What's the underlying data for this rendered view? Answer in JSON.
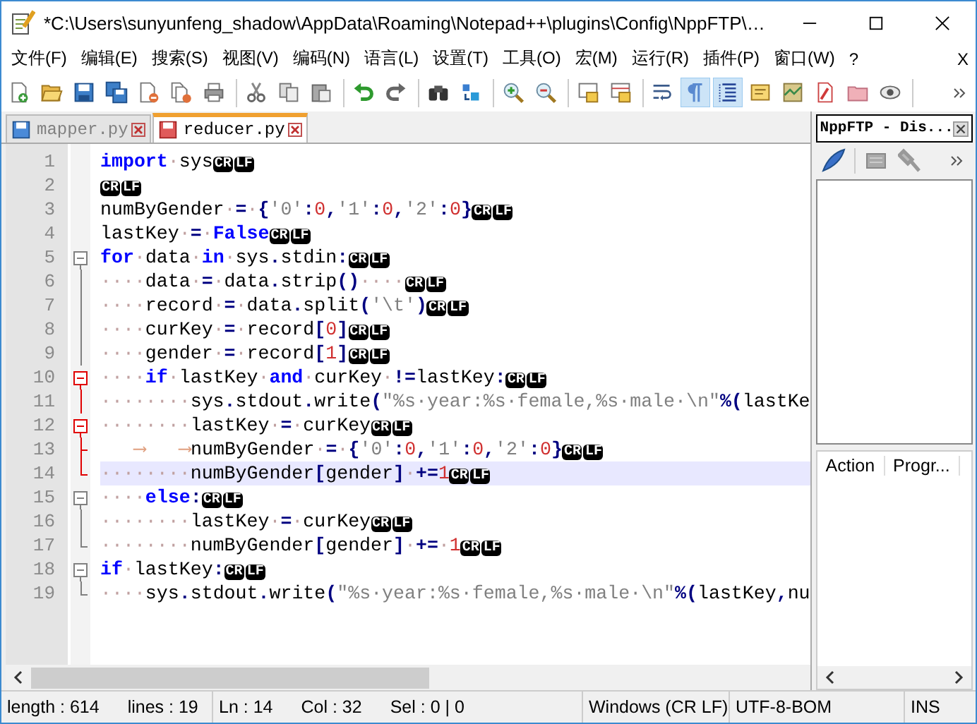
{
  "window": {
    "title": "*C:\\Users\\sunyunfeng_shadow\\AppData\\Roaming\\Notepad++\\plugins\\Config\\NppFTP\\…"
  },
  "menu": [
    "文件(F)",
    "编辑(E)",
    "搜索(S)",
    "视图(V)",
    "编码(N)",
    "语言(L)",
    "设置(T)",
    "工具(O)",
    "宏(M)",
    "运行(R)",
    "插件(P)",
    "窗口(W)",
    "?"
  ],
  "menu_close": "X",
  "toolbar": [
    {
      "kind": "new",
      "pressed": false
    },
    {
      "kind": "open",
      "pressed": false
    },
    {
      "kind": "save",
      "pressed": false
    },
    {
      "kind": "saveall",
      "pressed": false
    },
    {
      "kind": "close",
      "pressed": false
    },
    {
      "kind": "closeall",
      "pressed": false
    },
    {
      "kind": "print",
      "pressed": false
    },
    {
      "kind": "separator"
    },
    {
      "kind": "cut",
      "pressed": false
    },
    {
      "kind": "copy",
      "pressed": false
    },
    {
      "kind": "paste",
      "pressed": false
    },
    {
      "kind": "separator"
    },
    {
      "kind": "undo",
      "pressed": false
    },
    {
      "kind": "redo",
      "pressed": false
    },
    {
      "kind": "separator"
    },
    {
      "kind": "find",
      "pressed": false
    },
    {
      "kind": "replace",
      "pressed": false
    },
    {
      "kind": "separator"
    },
    {
      "kind": "zoomin",
      "pressed": false
    },
    {
      "kind": "zoomout",
      "pressed": false
    },
    {
      "kind": "separator"
    },
    {
      "kind": "syncv",
      "pressed": false
    },
    {
      "kind": "synch",
      "pressed": false
    },
    {
      "kind": "separator"
    },
    {
      "kind": "wrap",
      "pressed": false
    },
    {
      "kind": "pilcrow",
      "pressed": true
    },
    {
      "kind": "indent",
      "pressed": true
    },
    {
      "kind": "note",
      "pressed": false
    },
    {
      "kind": "map",
      "pressed": false
    },
    {
      "kind": "funclist",
      "pressed": false
    },
    {
      "kind": "folder",
      "pressed": false
    },
    {
      "kind": "eye",
      "pressed": false
    },
    {
      "kind": "separator"
    }
  ],
  "tabs": [
    {
      "label": "mapper.py",
      "selected": false,
      "modified": false
    },
    {
      "label": "reducer.py",
      "selected": true,
      "modified": true
    }
  ],
  "lines": [
    {
      "number": "1",
      "current": false,
      "tokens": [
        {
          "kind": "kw",
          "text": "import"
        },
        {
          "kind": "ws",
          "text": "·"
        },
        {
          "kind": "id",
          "text": "sys"
        },
        {
          "kind": "eol",
          "text": "CR"
        },
        {
          "kind": "eol",
          "text": "LF"
        }
      ]
    },
    {
      "number": "2",
      "current": false,
      "tokens": [
        {
          "kind": "eol",
          "text": "CR"
        },
        {
          "kind": "eol",
          "text": "LF"
        }
      ]
    },
    {
      "number": "3",
      "current": false,
      "tokens": [
        {
          "kind": "id",
          "text": "numByGender"
        },
        {
          "kind": "ws",
          "text": "·"
        },
        {
          "kind": "op",
          "text": "="
        },
        {
          "kind": "ws",
          "text": "·"
        },
        {
          "kind": "op",
          "text": "{"
        },
        {
          "kind": "str",
          "text": "'0'"
        },
        {
          "kind": "op",
          "text": ":"
        },
        {
          "kind": "num",
          "text": "0"
        },
        {
          "kind": "op",
          "text": ","
        },
        {
          "kind": "str",
          "text": "'1'"
        },
        {
          "kind": "op",
          "text": ":"
        },
        {
          "kind": "num",
          "text": "0"
        },
        {
          "kind": "op",
          "text": ","
        },
        {
          "kind": "str",
          "text": "'2'"
        },
        {
          "kind": "op",
          "text": ":"
        },
        {
          "kind": "num",
          "text": "0"
        },
        {
          "kind": "op",
          "text": "}"
        },
        {
          "kind": "eol",
          "text": "CR"
        },
        {
          "kind": "eol",
          "text": "LF"
        }
      ]
    },
    {
      "number": "4",
      "current": false,
      "tokens": [
        {
          "kind": "id",
          "text": "lastKey"
        },
        {
          "kind": "ws",
          "text": "·"
        },
        {
          "kind": "op",
          "text": "="
        },
        {
          "kind": "ws",
          "text": "·"
        },
        {
          "kind": "kw",
          "text": "False"
        },
        {
          "kind": "eol",
          "text": "CR"
        },
        {
          "kind": "eol",
          "text": "LF"
        }
      ]
    },
    {
      "number": "5",
      "fold_marker": {
        "kind": "open",
        "active": false
      },
      "current": false,
      "tokens": [
        {
          "kind": "kw",
          "text": "for"
        },
        {
          "kind": "ws",
          "text": "·"
        },
        {
          "kind": "id",
          "text": "data"
        },
        {
          "kind": "ws",
          "text": "·"
        },
        {
          "kind": "kw",
          "text": "in"
        },
        {
          "kind": "ws",
          "text": "·"
        },
        {
          "kind": "id",
          "text": "sys"
        },
        {
          "kind": "op",
          "text": "."
        },
        {
          "kind": "id",
          "text": "stdin"
        },
        {
          "kind": "op",
          "text": ":"
        },
        {
          "kind": "eol",
          "text": "CR"
        },
        {
          "kind": "eol",
          "text": "LF"
        }
      ]
    },
    {
      "number": "6",
      "fold_marker": {
        "kind": "line",
        "active": false
      },
      "current": false,
      "tokens": [
        {
          "kind": "ws",
          "text": "····"
        },
        {
          "kind": "id",
          "text": "data"
        },
        {
          "kind": "ws",
          "text": "·"
        },
        {
          "kind": "op",
          "text": "="
        },
        {
          "kind": "ws",
          "text": "·"
        },
        {
          "kind": "id",
          "text": "data"
        },
        {
          "kind": "op",
          "text": "."
        },
        {
          "kind": "id",
          "text": "strip"
        },
        {
          "kind": "op",
          "text": "()"
        },
        {
          "kind": "ws",
          "text": "····"
        },
        {
          "kind": "eol",
          "text": "CR"
        },
        {
          "kind": "eol",
          "text": "LF"
        }
      ]
    },
    {
      "number": "7",
      "fold_marker": {
        "kind": "line",
        "active": false
      },
      "current": false,
      "tokens": [
        {
          "kind": "ws",
          "text": "····"
        },
        {
          "kind": "id",
          "text": "record"
        },
        {
          "kind": "ws",
          "text": "·"
        },
        {
          "kind": "op",
          "text": "="
        },
        {
          "kind": "ws",
          "text": "·"
        },
        {
          "kind": "id",
          "text": "data"
        },
        {
          "kind": "op",
          "text": "."
        },
        {
          "kind": "id",
          "text": "split"
        },
        {
          "kind": "op",
          "text": "("
        },
        {
          "kind": "str",
          "text": "'\\t'"
        },
        {
          "kind": "op",
          "text": ")"
        },
        {
          "kind": "eol",
          "text": "CR"
        },
        {
          "kind": "eol",
          "text": "LF"
        }
      ]
    },
    {
      "number": "8",
      "fold_marker": {
        "kind": "line",
        "active": false
      },
      "current": false,
      "tokens": [
        {
          "kind": "ws",
          "text": "····"
        },
        {
          "kind": "id",
          "text": "curKey"
        },
        {
          "kind": "ws",
          "text": "·"
        },
        {
          "kind": "op",
          "text": "="
        },
        {
          "kind": "ws",
          "text": "·"
        },
        {
          "kind": "id",
          "text": "record"
        },
        {
          "kind": "op",
          "text": "["
        },
        {
          "kind": "num",
          "text": "0"
        },
        {
          "kind": "op",
          "text": "]"
        },
        {
          "kind": "eol",
          "text": "CR"
        },
        {
          "kind": "eol",
          "text": "LF"
        }
      ]
    },
    {
      "number": "9",
      "fold_marker": {
        "kind": "line",
        "active": false
      },
      "current": false,
      "tokens": [
        {
          "kind": "ws",
          "text": "····"
        },
        {
          "kind": "id",
          "text": "gender"
        },
        {
          "kind": "ws",
          "text": "·"
        },
        {
          "kind": "op",
          "text": "="
        },
        {
          "kind": "ws",
          "text": "·"
        },
        {
          "kind": "id",
          "text": "record"
        },
        {
          "kind": "op",
          "text": "["
        },
        {
          "kind": "num",
          "text": "1"
        },
        {
          "kind": "op",
          "text": "]"
        },
        {
          "kind": "eol",
          "text": "CR"
        },
        {
          "kind": "eol",
          "text": "LF"
        }
      ]
    },
    {
      "number": "10",
      "fold_marker": {
        "kind": "open",
        "active": true
      },
      "current": false,
      "tokens": [
        {
          "kind": "ws",
          "text": "····"
        },
        {
          "kind": "kw",
          "text": "if"
        },
        {
          "kind": "ws",
          "text": "·"
        },
        {
          "kind": "id",
          "text": "lastKey"
        },
        {
          "kind": "ws",
          "text": "·"
        },
        {
          "kind": "kw",
          "text": "and"
        },
        {
          "kind": "ws",
          "text": "·"
        },
        {
          "kind": "id",
          "text": "curKey"
        },
        {
          "kind": "ws",
          "text": "·"
        },
        {
          "kind": "op",
          "text": "!="
        },
        {
          "kind": "id",
          "text": "lastKey"
        },
        {
          "kind": "op",
          "text": ":"
        },
        {
          "kind": "eol",
          "text": "CR"
        },
        {
          "kind": "eol",
          "text": "LF"
        }
      ]
    },
    {
      "number": "11",
      "fold_marker": {
        "kind": "line",
        "active": true
      },
      "current": false,
      "tokens": [
        {
          "kind": "ws",
          "text": "········"
        },
        {
          "kind": "id",
          "text": "sys"
        },
        {
          "kind": "op",
          "text": "."
        },
        {
          "kind": "id",
          "text": "stdout"
        },
        {
          "kind": "op",
          "text": "."
        },
        {
          "kind": "id",
          "text": "write"
        },
        {
          "kind": "op",
          "text": "("
        },
        {
          "kind": "str",
          "text": "\"%s·year:%s·female,%s·male·\\n\""
        },
        {
          "kind": "op",
          "text": "%("
        },
        {
          "kind": "id",
          "text": "lastKe"
        }
      ]
    },
    {
      "number": "12",
      "fold_marker": {
        "kind": "open",
        "active": true
      },
      "current": false,
      "tokens": [
        {
          "kind": "ws",
          "text": "········"
        },
        {
          "kind": "id",
          "text": "lastKey"
        },
        {
          "kind": "ws",
          "text": "·"
        },
        {
          "kind": "op",
          "text": "="
        },
        {
          "kind": "ws",
          "text": "·"
        },
        {
          "kind": "id",
          "text": "curKey"
        },
        {
          "kind": "eol",
          "text": "CR"
        },
        {
          "kind": "eol",
          "text": "LF"
        }
      ]
    },
    {
      "number": "13",
      "fold_marker": {
        "kind": "branch",
        "active": true
      },
      "current": false,
      "tokens": [
        {
          "kind": "tab",
          "text": "⟶"
        },
        {
          "kind": "tab",
          "text": "⟶"
        },
        {
          "kind": "id",
          "text": "numByGender"
        },
        {
          "kind": "ws",
          "text": "·"
        },
        {
          "kind": "op",
          "text": "="
        },
        {
          "kind": "ws",
          "text": "·"
        },
        {
          "kind": "op",
          "text": "{"
        },
        {
          "kind": "str",
          "text": "'0'"
        },
        {
          "kind": "op",
          "text": ":"
        },
        {
          "kind": "num",
          "text": "0"
        },
        {
          "kind": "op",
          "text": ","
        },
        {
          "kind": "str",
          "text": "'1'"
        },
        {
          "kind": "op",
          "text": ":"
        },
        {
          "kind": "num",
          "text": "0"
        },
        {
          "kind": "op",
          "text": ","
        },
        {
          "kind": "str",
          "text": "'2'"
        },
        {
          "kind": "op",
          "text": ":"
        },
        {
          "kind": "num",
          "text": "0"
        },
        {
          "kind": "op",
          "text": "}"
        },
        {
          "kind": "eol",
          "text": "CR"
        },
        {
          "kind": "eol",
          "text": "LF"
        }
      ]
    },
    {
      "number": "14",
      "fold_marker": {
        "kind": "end",
        "active": true
      },
      "current": true,
      "tokens": [
        {
          "kind": "ws",
          "text": "········"
        },
        {
          "kind": "id",
          "text": "numByGender"
        },
        {
          "kind": "op",
          "text": "["
        },
        {
          "kind": "id",
          "text": "gender"
        },
        {
          "kind": "op",
          "text": "]"
        },
        {
          "kind": "ws",
          "text": "·"
        },
        {
          "kind": "op",
          "text": "+="
        },
        {
          "kind": "num",
          "text": "1"
        },
        {
          "kind": "eol",
          "text": "CR"
        },
        {
          "kind": "eol",
          "text": "LF"
        }
      ]
    },
    {
      "number": "15",
      "fold_marker": {
        "kind": "open",
        "active": false
      },
      "current": false,
      "tokens": [
        {
          "kind": "ws",
          "text": "····"
        },
        {
          "kind": "kw",
          "text": "else"
        },
        {
          "kind": "op",
          "text": ":"
        },
        {
          "kind": "eol",
          "text": "CR"
        },
        {
          "kind": "eol",
          "text": "LF"
        }
      ]
    },
    {
      "number": "16",
      "fold_marker": {
        "kind": "line",
        "active": false
      },
      "current": false,
      "tokens": [
        {
          "kind": "ws",
          "text": "········"
        },
        {
          "kind": "id",
          "text": "lastKey"
        },
        {
          "kind": "ws",
          "text": "·"
        },
        {
          "kind": "op",
          "text": "="
        },
        {
          "kind": "ws",
          "text": "·"
        },
        {
          "kind": "id",
          "text": "curKey"
        },
        {
          "kind": "eol",
          "text": "CR"
        },
        {
          "kind": "eol",
          "text": "LF"
        }
      ]
    },
    {
      "number": "17",
      "fold_marker": {
        "kind": "end",
        "active": false
      },
      "current": false,
      "tokens": [
        {
          "kind": "ws",
          "text": "········"
        },
        {
          "kind": "id",
          "text": "numByGender"
        },
        {
          "kind": "op",
          "text": "["
        },
        {
          "kind": "id",
          "text": "gender"
        },
        {
          "kind": "op",
          "text": "]"
        },
        {
          "kind": "ws",
          "text": "·"
        },
        {
          "kind": "op",
          "text": "+="
        },
        {
          "kind": "ws",
          "text": "·"
        },
        {
          "kind": "num",
          "text": "1"
        },
        {
          "kind": "eol",
          "text": "CR"
        },
        {
          "kind": "eol",
          "text": "LF"
        }
      ]
    },
    {
      "number": "18",
      "fold_marker": {
        "kind": "open",
        "active": false
      },
      "current": false,
      "tokens": [
        {
          "kind": "kw",
          "text": "if"
        },
        {
          "kind": "ws",
          "text": "·"
        },
        {
          "kind": "id",
          "text": "lastKey"
        },
        {
          "kind": "op",
          "text": ":"
        },
        {
          "kind": "eol",
          "text": "CR"
        },
        {
          "kind": "eol",
          "text": "LF"
        }
      ]
    },
    {
      "number": "19",
      "fold_marker": {
        "kind": "end",
        "active": false
      },
      "current": false,
      "tokens": [
        {
          "kind": "ws",
          "text": "····"
        },
        {
          "kind": "id",
          "text": "sys"
        },
        {
          "kind": "op",
          "text": "."
        },
        {
          "kind": "id",
          "text": "stdout"
        },
        {
          "kind": "op",
          "text": "."
        },
        {
          "kind": "id",
          "text": "write"
        },
        {
          "kind": "op",
          "text": "("
        },
        {
          "kind": "str",
          "text": "\"%s·year:%s·female,%s·male·\\n\""
        },
        {
          "kind": "op",
          "text": "%("
        },
        {
          "kind": "id",
          "text": "lastKey"
        },
        {
          "kind": "op",
          "text": ","
        },
        {
          "kind": "id",
          "text": "nu"
        }
      ]
    }
  ],
  "panel": {
    "title": "NppFTP - Dis...",
    "columns": [
      "Action",
      "Progr..."
    ]
  },
  "status_bar": {
    "length": "length : 614",
    "lines": "lines : 19",
    "ln": "Ln : 14",
    "col": "Col : 32",
    "sel": "Sel : 0 | 0",
    "eol": "Windows (CR LF)",
    "encoding": "UTF-8-BOM",
    "mode": "INS"
  }
}
